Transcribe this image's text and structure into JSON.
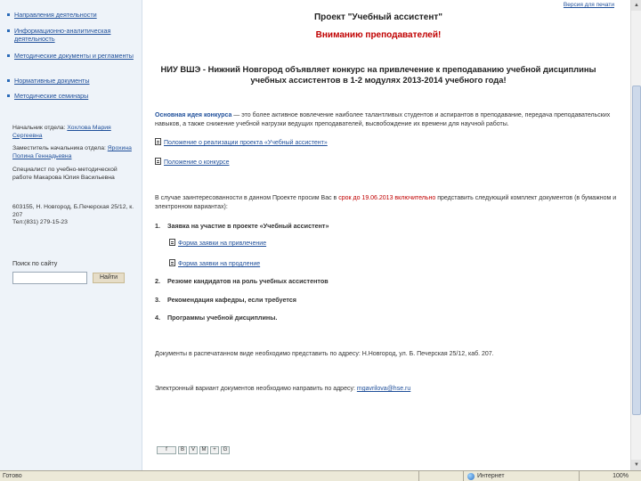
{
  "sidebar": {
    "nav": [
      {
        "label": "Направления деятельности"
      },
      {
        "label": "Информационно-аналитическая деятельность"
      },
      {
        "label": "Методические документы и регламенты"
      },
      {
        "label": "Нормативные документы"
      },
      {
        "label": "Методические семинары"
      }
    ],
    "contacts": [
      {
        "prefix": "Начальник отдела: ",
        "name": "Хохлова Мария Сергеевна"
      },
      {
        "prefix": "Заместитель начальника отдела: ",
        "name": "Ярохина Полина Геннадьевна"
      }
    ],
    "specialist": "Специалист по учебно-методической работе Макарова Юлия Васильевна",
    "address": "603155, Н. Новгород, Б.Печерская 25/12, к. 207",
    "phone": "Тел:(831) 279-15-23",
    "search": {
      "label": "Поиск по сайту",
      "placeholder": "",
      "button": "Найти"
    }
  },
  "main": {
    "top_link": "Версия для печати",
    "project_title": "Проект \"Учебный ассистент\"",
    "attention": "Вниманию преподавателей!",
    "announce_line1": "НИУ ВШЭ - Нижний Новгород объявляет конкурс на привлечение к преподаванию учебной дисциплины",
    "announce_line2": "учебных ассистентов в 1-2 модулях 2013-2014 учебного года!",
    "idea_label": "Основная идея конкурса",
    "idea_text": " — это более активное вовлечение наиболее талантливых студентов и аспирантов в преподавание, передача преподавательских навыков, а также снижение учебной нагрузки ведущих преподавателей, высвобождение их времени для научной работы.",
    "doc_links": [
      "Положение о реализации проекта «Учебный ассистент»",
      "Положение о конкурсе"
    ],
    "deadline_before": "В случае заинтересованности в данном Проекте просим Вас в ",
    "deadline_red": "срок до 19.06.2013 включительно",
    "deadline_after": " представить следующий комплект документов (в бумажном и электронном вариантах):",
    "items": [
      {
        "num": "1.",
        "label": "Заявка на участие в проекте «Учебный ассистент»"
      },
      {
        "num": "2.",
        "label": "Резюме кандидатов на роль учебных ассистентов"
      },
      {
        "num": "3.",
        "label": "Рекомендация кафедры, если требуется"
      },
      {
        "num": "4.",
        "label": "Программы учебной дисциплины."
      }
    ],
    "sublinks": [
      "Форма заявки на привлечение",
      "Форма заявки на продление"
    ],
    "paper_note": "Документы в распечатанном виде необходимо представить по адресу: Н.Новгород, ул. Б. Печерская 25/12, каб. 207.",
    "email_before": "Электронный вариант документов необходимо направить по адресу: ",
    "email": "mgavrilova@hse.ru",
    "share": [
      "f",
      "B",
      "V",
      "M",
      "+",
      "G"
    ]
  },
  "statusbar": {
    "status": "Готово",
    "zone": "Интернет",
    "zoom": "100%"
  },
  "colors": {
    "link": "#1f4f9a",
    "alert": "#c00000",
    "sidebar_bg": "#eef3f9"
  }
}
